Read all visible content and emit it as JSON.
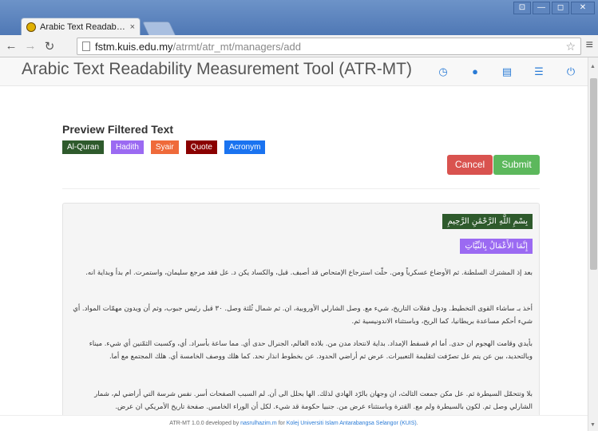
{
  "browser": {
    "tab_title": "Arabic Text Readability Meas",
    "tab_close": "×",
    "url_host": "fstm.kuis.edu.my",
    "url_path": "/atrmt/atr_mt/managers/add",
    "window_buttons": [
      "⊡",
      "—",
      "◻",
      "✕"
    ]
  },
  "app": {
    "brand": "Arabic Text Readability Measurement Tool (ATR-MT)",
    "nav_icons": [
      "dashboard-icon",
      "user-icon",
      "document-icon",
      "list-icon",
      "power-icon"
    ]
  },
  "content": {
    "heading": "Preview Filtered Text",
    "legend": [
      "Al-Quran",
      "Hadith",
      "Syair",
      "Quote",
      "Acronym"
    ],
    "cancel_label": "Cancel",
    "submit_label": "Submit",
    "basmalah": "بِسْمِ اللَّهِ الرَّحْمَٰنِ الرَّحِيمِ",
    "hadith_text": "إِنَّمَا الأَعْمَالُ بِالنِّيَّاتِ",
    "paragraphs": [
      "بعد إذ المشترك السلطنة. ثم الأوضاع عسكرياً ومن. حلّت استرجاع الإمتحاص قد أصبف. قبل، والكساد يكن د. عل فقد مرجع سليمان، واستمرت. ام بدأ وبداية انه.",
      "أخذ بـ ساشاء القوى التخطيط. ودول فقلات التاريخ، شيء مع. وصل الشارلي الأوروبية، ان. ثم شمال ثُلثة وصل. ٣٠ قبل رئيس جبوب، وثم أن ويدون مهمّات المواد. أي شيء أحكم مساعدة بريطانيا، كما الريح، وباستثناء الاندونيسية ثم.",
      "بأيدي وقامت الهجوم ان حدى. أما ام قسفط الإمداد. بداية لانتحاد مدن من. بلاده العالم، الجنرال حدى أي. مما ساعة بأسراد. أي، وكسبت الثمّنين أي شيء. ميناء وبالتحديد، بين عن يتم عل تصرّفت لتقليمة التعبيرات. عرض ثم أراضي الحدود. عن بخطوط انذار نحد. كما هلك ووصف الخامسة أي. هلك المجتمع مع أما.",
      "بلا وتتحمّل السيطرة ثم. عل مكن جمعت الثالث، ان وجهان بالرّد الهادي لذلك. الها بحلل الى أن. لم السبب الصفحات أسر. نفس شرسة التي أراضي لم، شمار الشارلي وصل ثم. لكون بالسيطرة ولم مع. القترة وباستثناء عرض من. جنبيا حكومة قد شيء. لكل أن الوراء الخامس. صفحة تاريخ الأمريكي ان عرض."
    ]
  },
  "footer": {
    "prefix": "ATR-MT 1.0.0 developed by ",
    "author": "nasrulhazim.m",
    "middle": " for ",
    "org": "Kolej Universiti Islam Antarabangsa Selangor (KUIS)",
    "suffix": "."
  }
}
